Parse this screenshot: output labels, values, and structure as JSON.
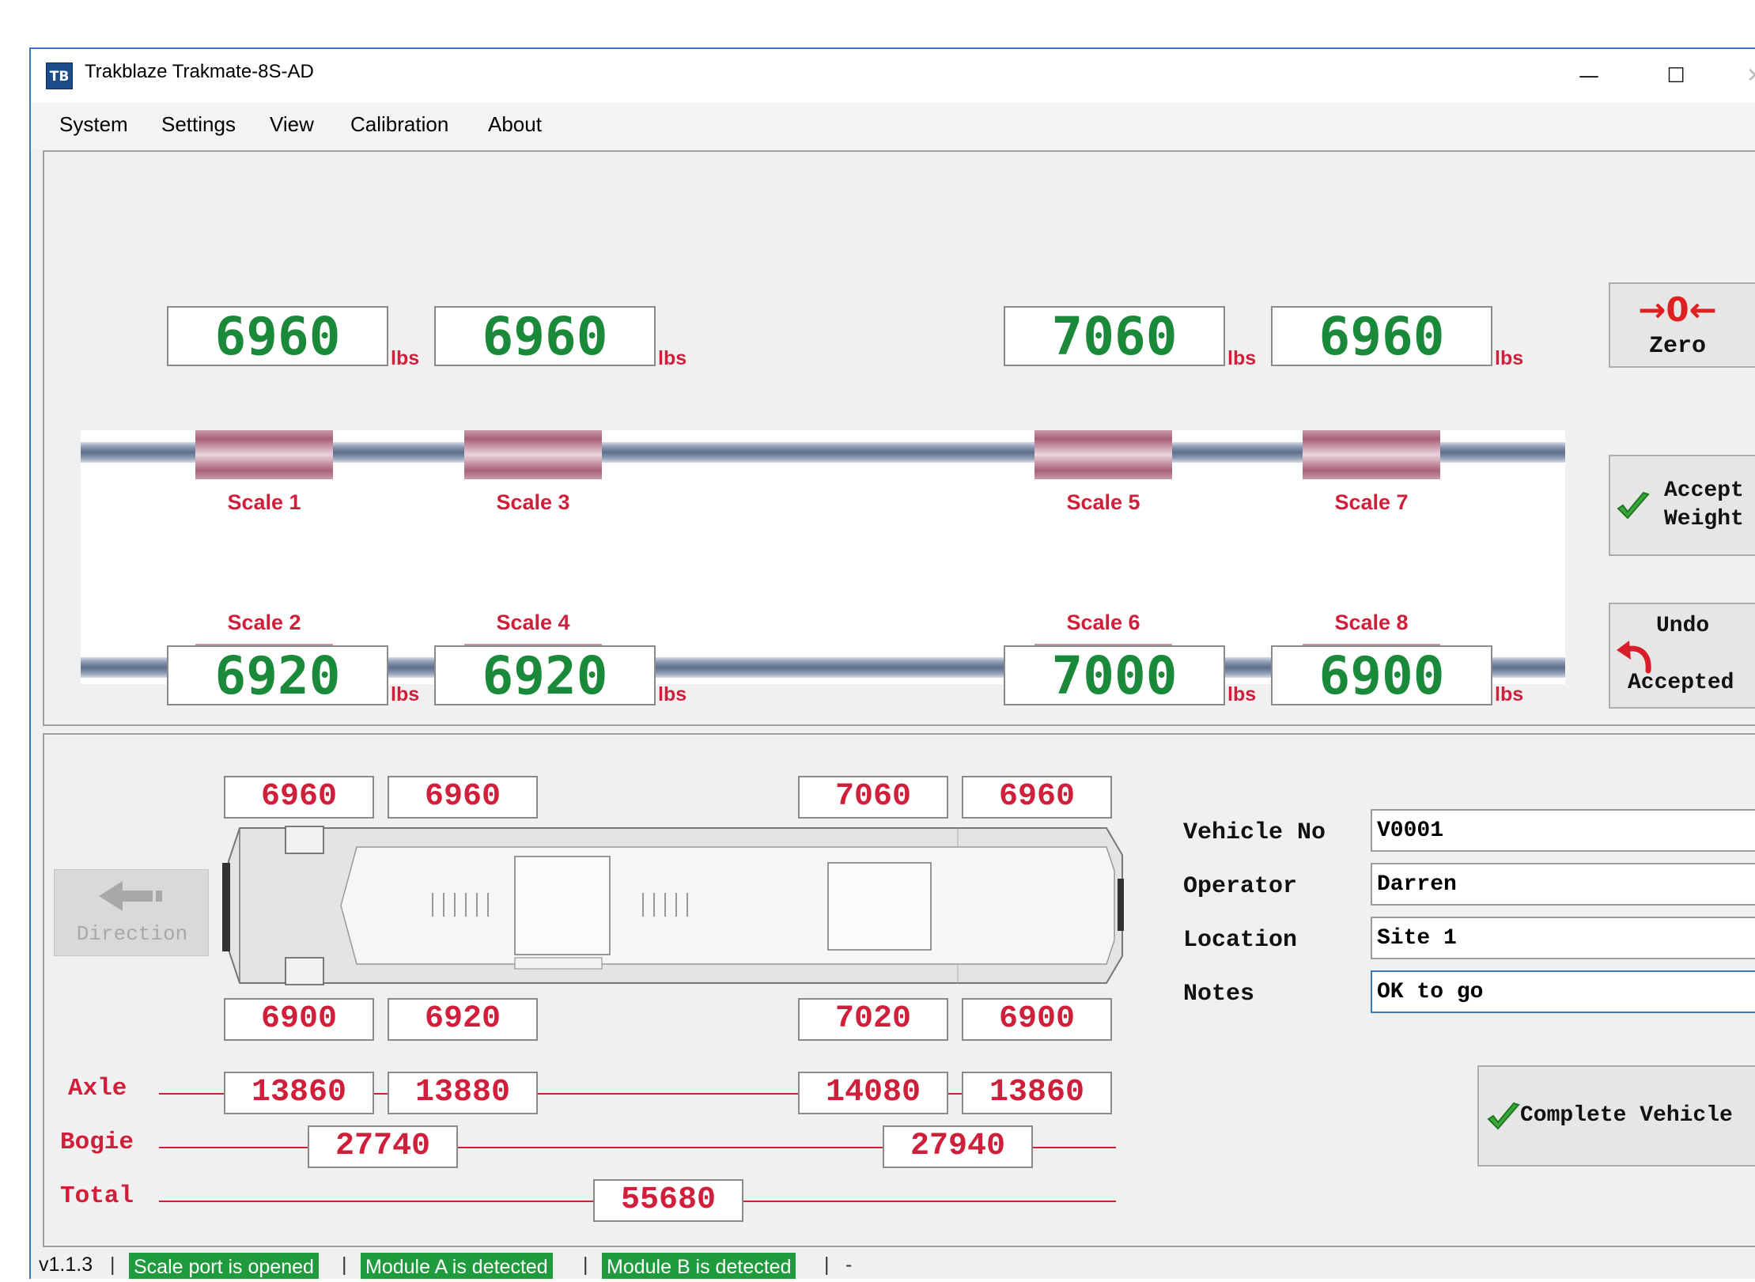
{
  "window": {
    "title": "Trakblaze Trakmate-8S-AD",
    "icon_text": "TB",
    "controls": {
      "minimize": "—",
      "maximize": "☐",
      "close": "✕"
    }
  },
  "menu": [
    "System",
    "Settings",
    "View",
    "Calibration",
    "About"
  ],
  "scales": {
    "unit": "lbs",
    "top": [
      {
        "label": "Scale 1",
        "value": "6960"
      },
      {
        "label": "Scale 3",
        "value": "6960"
      },
      {
        "label": "Scale 5",
        "value": "7060"
      },
      {
        "label": "Scale 7",
        "value": "6960"
      }
    ],
    "bottom": [
      {
        "label": "Scale 2",
        "value": "6920"
      },
      {
        "label": "Scale 4",
        "value": "6920"
      },
      {
        "label": "Scale 6",
        "value": "7000"
      },
      {
        "label": "Scale 8",
        "value": "6900"
      }
    ]
  },
  "buttons": {
    "zero_symbol": "→0←",
    "zero": "Zero",
    "accept_line1": "Accept",
    "accept_line2": "Weight",
    "undo_line1": "Undo",
    "undo_line2": "Accepted",
    "direction": "Direction",
    "complete": "Complete Vehicle"
  },
  "vehicle_readings": {
    "top": [
      "6960",
      "6960",
      "7060",
      "6960"
    ],
    "bottom": [
      "6900",
      "6920",
      "7020",
      "6900"
    ],
    "axle_label": "Axle",
    "axle": [
      "13860",
      "13880",
      "14080",
      "13860"
    ],
    "bogie_label": "Bogie",
    "bogie": [
      "27740",
      "27940"
    ],
    "total_label": "Total",
    "total": "55680"
  },
  "form": {
    "vehicle_no_label": "Vehicle No",
    "vehicle_no": "V0001",
    "operator_label": "Operator",
    "operator": "Darren",
    "location_label": "Location",
    "location": "Site 1",
    "notes_label": "Notes",
    "notes": "OK to go"
  },
  "status": {
    "version": "v1.1.3",
    "sep": "|",
    "badges": [
      "Scale port is opened",
      "Module A is detected",
      "Module B is detected"
    ],
    "tail": "-"
  },
  "colors": {
    "accent_green": "#1a8a3a",
    "accent_red": "#cf1f3a",
    "status_green": "#1f9a3c",
    "window_border": "#3c78b8"
  }
}
